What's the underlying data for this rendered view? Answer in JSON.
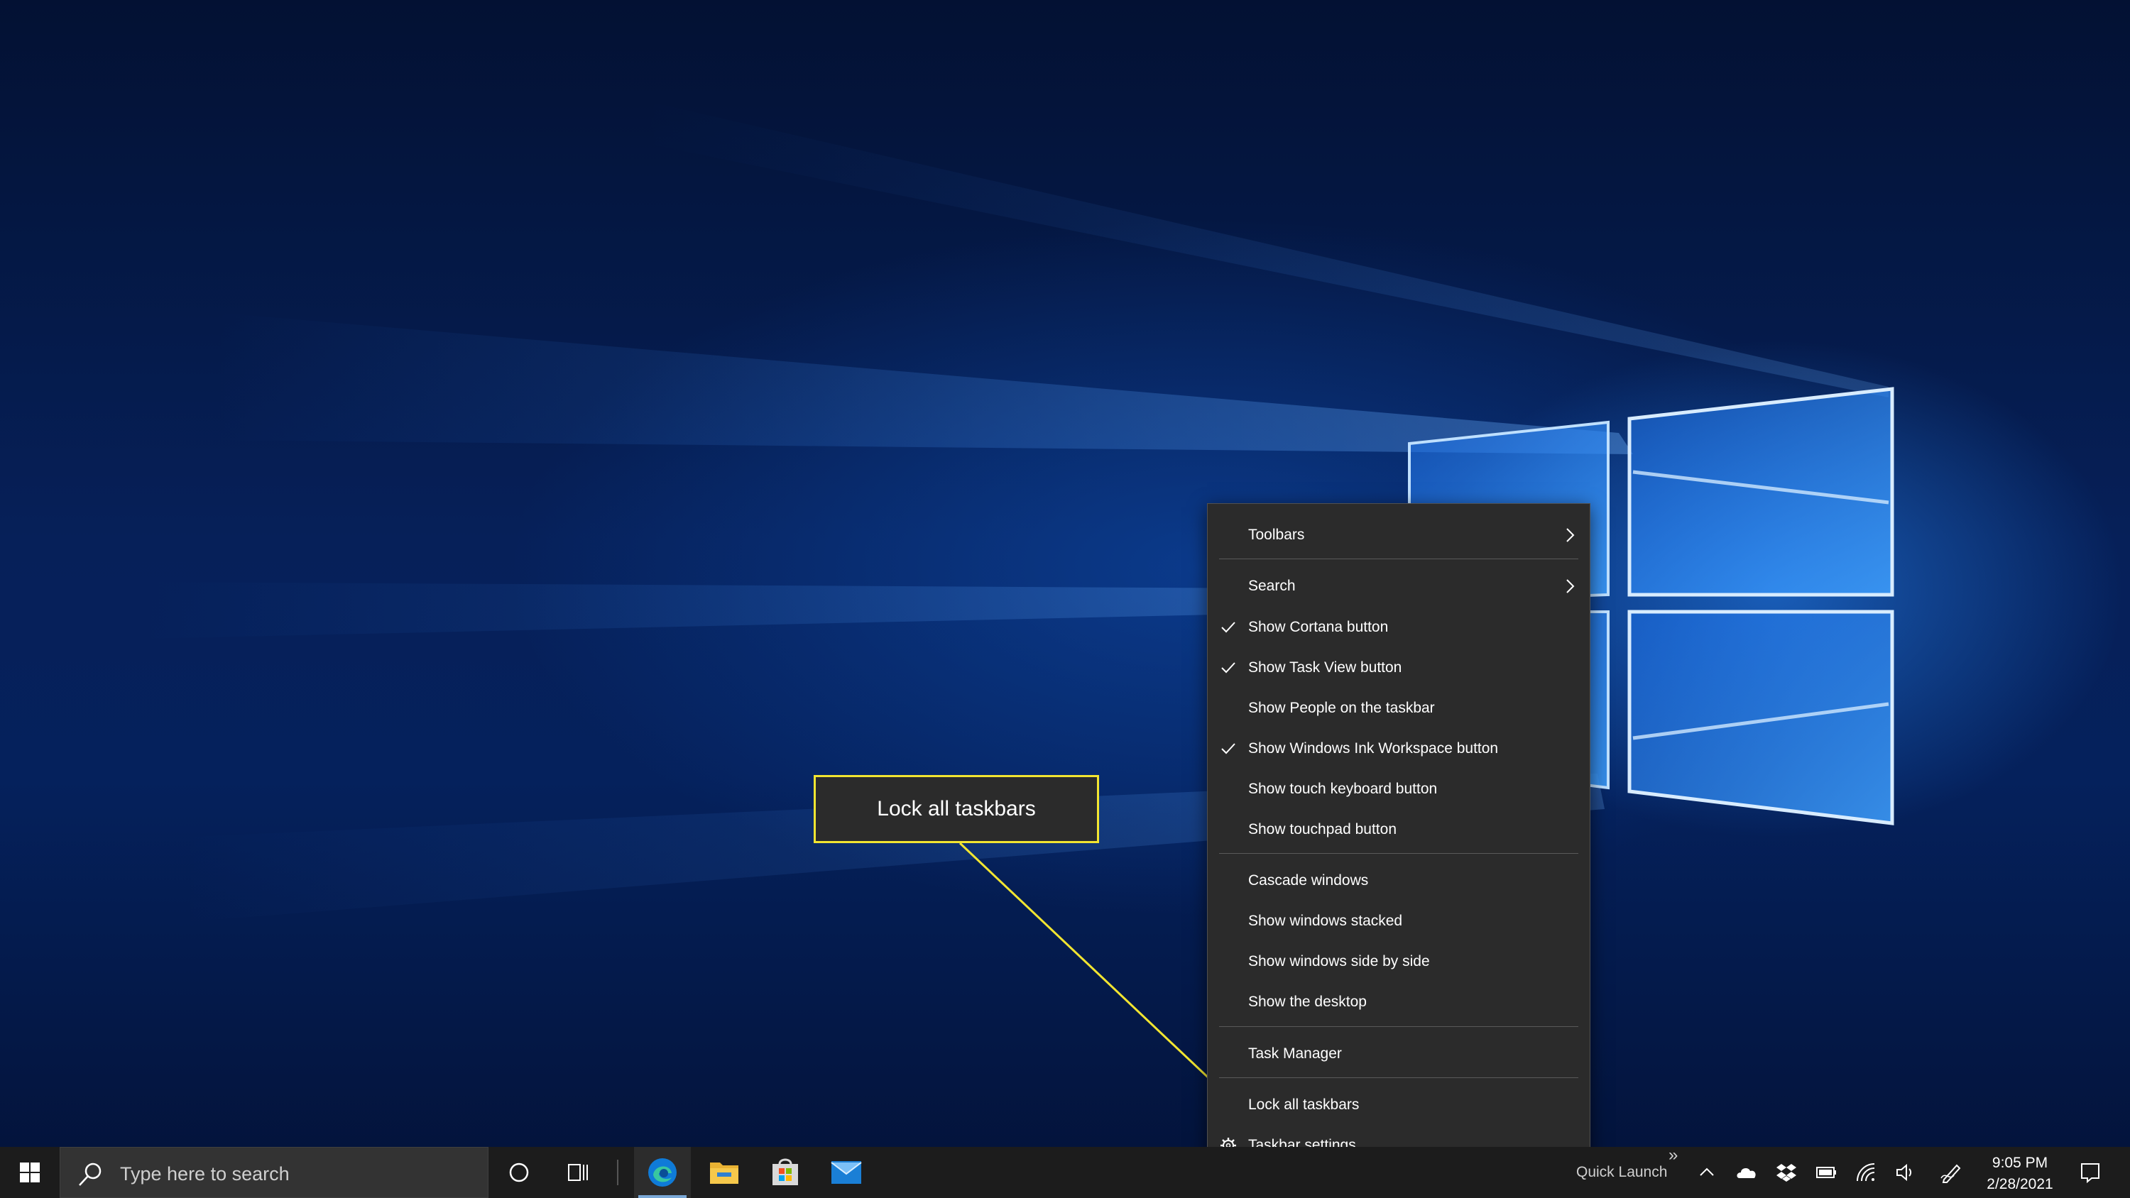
{
  "context_menu": {
    "items": [
      {
        "label": "Toolbars"
      },
      {
        "label": "Search"
      },
      {
        "label": "Show Cortana button"
      },
      {
        "label": "Show Task View button"
      },
      {
        "label": "Show People on the taskbar"
      },
      {
        "label": "Show Windows Ink Workspace button"
      },
      {
        "label": "Show touch keyboard button"
      },
      {
        "label": "Show touchpad button"
      },
      {
        "label": "Cascade windows"
      },
      {
        "label": "Show windows stacked"
      },
      {
        "label": "Show windows side by side"
      },
      {
        "label": "Show the desktop"
      },
      {
        "label": "Task Manager"
      },
      {
        "label": "Lock all taskbars"
      },
      {
        "label": "Taskbar settings"
      }
    ]
  },
  "callout": {
    "label": "Lock all taskbars",
    "color": "#f2e531"
  },
  "taskbar": {
    "search_placeholder": "Type here to search",
    "pinned_apps": [
      "edge-icon",
      "file-explorer-icon",
      "microsoft-store-icon",
      "mail-icon"
    ],
    "quick_launch_label": "Quick Launch",
    "quick_launch_chevron": "»",
    "clock": {
      "time": "9:05 PM",
      "date": "2/28/2021"
    }
  },
  "colors": {
    "menu_bg": "#2b2b2b",
    "taskbar_bg": "#1c1c1c",
    "accent": "#0078d7"
  }
}
